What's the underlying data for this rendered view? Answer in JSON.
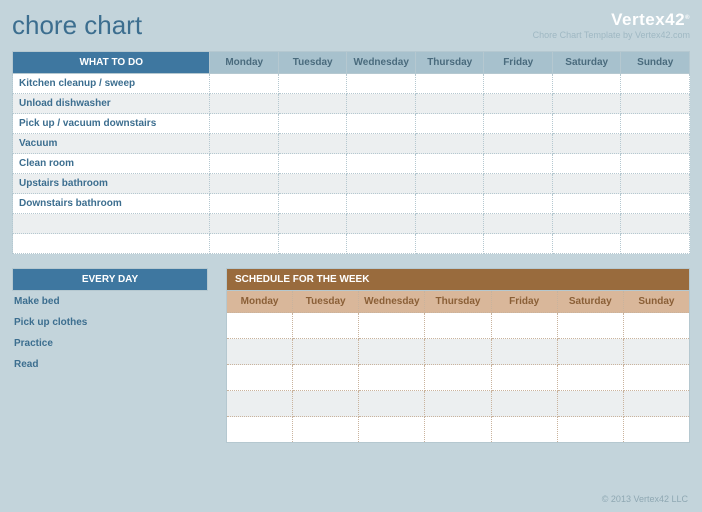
{
  "header": {
    "title": "chore chart",
    "logo_text": "Vertex",
    "logo_suffix": "42",
    "byline": "Chore Chart Template by Vertex42.com"
  },
  "what_to_do": {
    "header": "WHAT TO DO",
    "days": [
      "Monday",
      "Tuesday",
      "Wednesday",
      "Thursday",
      "Friday",
      "Saturday",
      "Sunday"
    ],
    "rows": [
      "Kitchen cleanup / sweep",
      "Unload dishwasher",
      "Pick up / vacuum downstairs",
      "Vacuum",
      "Clean room",
      "Upstairs bathroom",
      "Downstairs bathroom",
      "",
      ""
    ]
  },
  "every_day": {
    "header": "EVERY DAY",
    "items": [
      "Make bed",
      "Pick up clothes",
      "Practice",
      "Read"
    ]
  },
  "schedule": {
    "header": "SCHEDULE FOR THE WEEK",
    "days": [
      "Monday",
      "Tuesday",
      "Wednesday",
      "Thursday",
      "Friday",
      "Saturday",
      "Sunday"
    ],
    "row_count": 5
  },
  "footer": "© 2013 Vertex42 LLC"
}
